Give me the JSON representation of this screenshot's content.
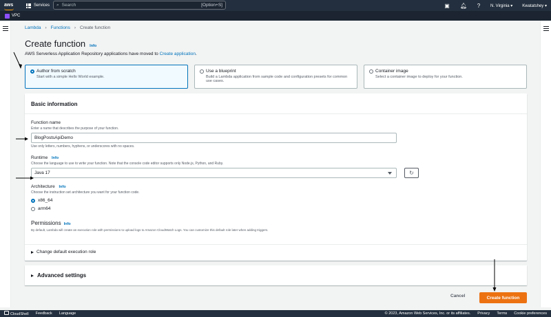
{
  "topnav": {
    "logo": "aws",
    "services_label": "Services",
    "search_placeholder": "Search",
    "search_shortcut": "[Option+S]",
    "region": "N. Virginia",
    "account": "Kwatatshey"
  },
  "subnav": {
    "service": "VPC"
  },
  "breadcrumb": {
    "items": [
      "Lambda",
      "Functions",
      "Create function"
    ]
  },
  "page": {
    "title": "Create function",
    "info": "Info",
    "moved_text": "AWS Serverless Application Repository applications have moved to ",
    "moved_link": "Create application",
    "moved_end": "."
  },
  "options": [
    {
      "title": "Author from scratch",
      "desc": "Start with a simple Hello World example."
    },
    {
      "title": "Use a blueprint",
      "desc": "Build a Lambda application from sample code and configuration presets for common use cases."
    },
    {
      "title": "Container image",
      "desc": "Select a container image to deploy for your function."
    }
  ],
  "basic": {
    "header": "Basic information",
    "fn_name_label": "Function name",
    "fn_name_desc": "Enter a name that describes the purpose of your function.",
    "fn_name_value": "BlogPostsApiDemo",
    "fn_name_hint": "Use only letters, numbers, hyphens, or underscores with no spaces.",
    "runtime_label": "Runtime",
    "runtime_info": "Info",
    "runtime_desc": "Choose the language to use to write your function. Note that the console code editor supports only Node.js, Python, and Ruby.",
    "runtime_value": "Java 17",
    "arch_label": "Architecture",
    "arch_info": "Info",
    "arch_desc": "Choose the instruction set architecture you want for your function code.",
    "arch_options": [
      "x86_64",
      "arm64"
    ],
    "perm_label": "Permissions",
    "perm_info": "Info",
    "perm_desc": "By default, Lambda will create an execution role with permissions to upload logs to Amazon CloudWatch Logs. You can customize this default role later when adding triggers.",
    "exec_role": "Change default execution role"
  },
  "advanced": {
    "label": "Advanced settings"
  },
  "actions": {
    "cancel": "Cancel",
    "create": "Create function"
  },
  "footer": {
    "cloudshell": "CloudShell",
    "feedback": "Feedback",
    "language": "Language",
    "copyright": "© 2023, Amazon Web Services, Inc. or its affiliates.",
    "privacy": "Privacy",
    "terms": "Terms",
    "cookies": "Cookie preferences"
  },
  "colors": {
    "accent": "#0073bb",
    "primary_button": "#ec7211",
    "nav_bg": "#232f3e"
  }
}
